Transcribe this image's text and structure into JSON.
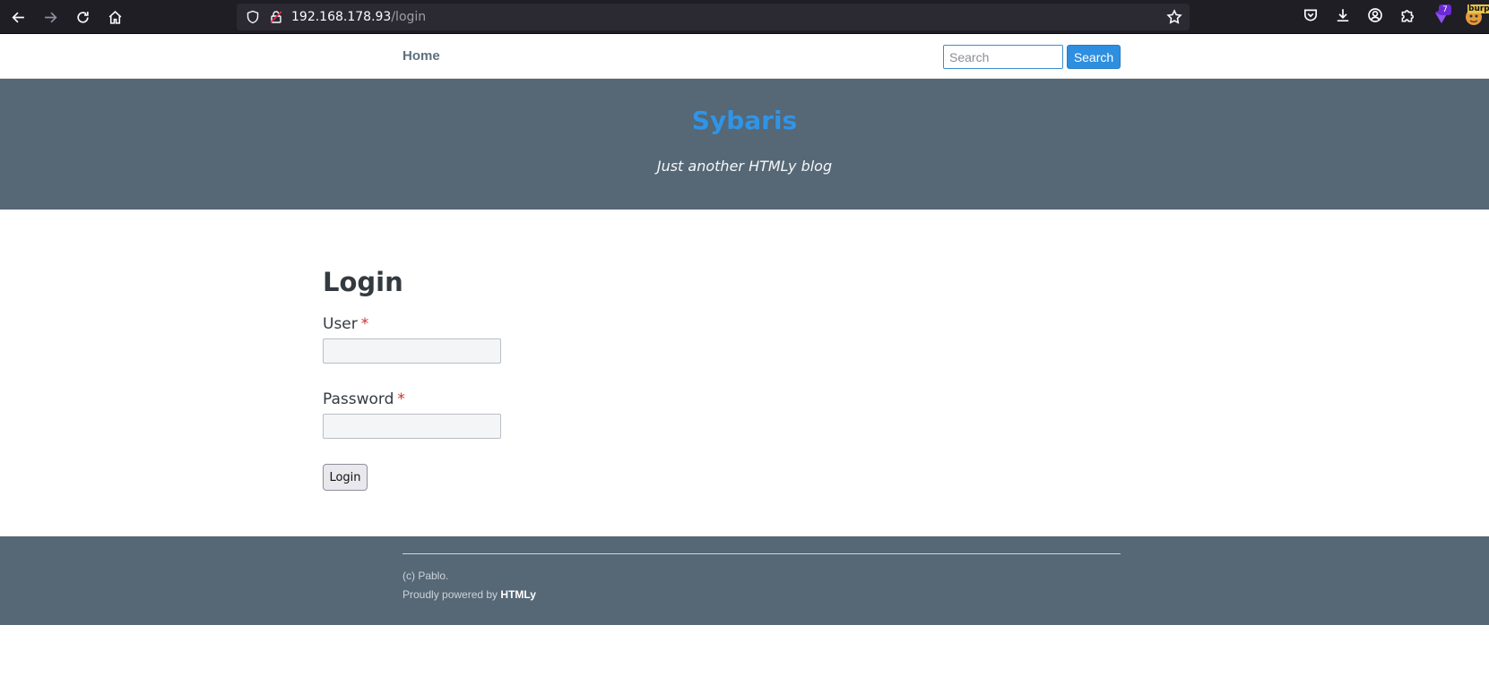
{
  "browser": {
    "url_host": "192.168.178.93",
    "url_path": "/login",
    "extension_badge": "7",
    "extension_label": "burp"
  },
  "nav": {
    "home_label": "Home",
    "search_placeholder": "Search",
    "search_button": "Search"
  },
  "hero": {
    "title": "Sybaris",
    "tagline": "Just another HTMLy blog"
  },
  "login": {
    "title": "Login",
    "user_label": "User",
    "password_label": "Password",
    "required_mark": "*",
    "submit_label": "Login"
  },
  "footer": {
    "copyright": "(c) Pablo.",
    "powered_prefix": "Proudly powered by",
    "powered_link": "HTMLy"
  },
  "colors": {
    "header_bg": "#566775",
    "title_blue": "#2e95e8",
    "search_button_bg": "#2e8fe0",
    "required_red": "#d0312d"
  }
}
